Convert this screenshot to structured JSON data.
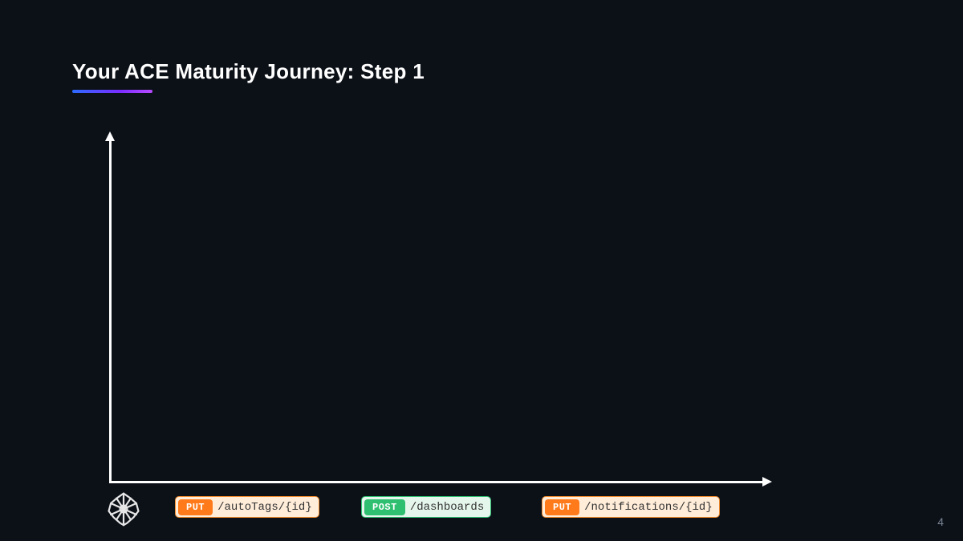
{
  "title": "Your ACE Maturity Journey: Step 1",
  "page_number": "4",
  "chart_data": {
    "type": "line",
    "title": "",
    "xlabel": "",
    "ylabel": "",
    "series": [],
    "note": "empty axes only; no data series rendered on this slide"
  },
  "api_pills": [
    {
      "method": "PUT",
      "path": "/autoTags/{id}",
      "style": "orange"
    },
    {
      "method": "POST",
      "path": "/dashboards",
      "style": "green"
    },
    {
      "method": "PUT",
      "path": "/notifications/{id}",
      "style": "orange"
    }
  ]
}
